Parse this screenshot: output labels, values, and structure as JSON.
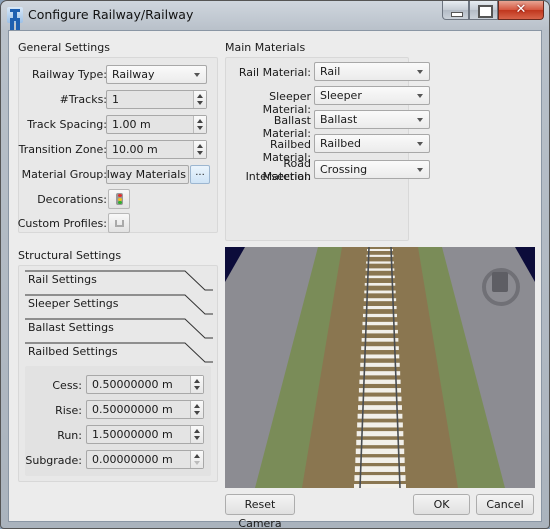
{
  "window": {
    "title": "Configure Railway/Railway",
    "controls": {
      "minimize": "minimize",
      "maximize": "maximize",
      "close": "✕"
    }
  },
  "general_settings": {
    "title": "General Settings",
    "railway_type": {
      "label": "Railway Type:",
      "value": "Railway"
    },
    "tracks": {
      "label": "#Tracks:",
      "value": "1"
    },
    "track_spacing": {
      "label": "Track Spacing:",
      "value": "1.00 m"
    },
    "transition_zone": {
      "label": "Transition Zone:",
      "value": "10.00 m"
    },
    "material_group": {
      "label": "Material Group:",
      "value": "/Railway Materials",
      "browse_label": "..."
    },
    "decorations": {
      "label": "Decorations:",
      "icon": "traffic-light-icon"
    },
    "custom_profiles": {
      "label": "Custom Profiles:",
      "icon": "profile-icon"
    }
  },
  "main_materials": {
    "title": "Main Materials",
    "rail": {
      "label": "Rail Material:",
      "value": "Rail"
    },
    "sleeper": {
      "label": "Sleeper Material:",
      "value": "Sleeper"
    },
    "ballast": {
      "label": "Ballast Material:",
      "value": "Ballast"
    },
    "railbed": {
      "label": "Railbed Material:",
      "value": "Railbed"
    },
    "road_intersection": {
      "label_line1": "Road Intersection",
      "label_line2": "Material:",
      "value": "Crossing"
    }
  },
  "structural_settings": {
    "title": "Structural Settings",
    "tabs": [
      {
        "label": "Rail Settings"
      },
      {
        "label": "Sleeper Settings"
      },
      {
        "label": "Ballast Settings"
      },
      {
        "label": "Railbed Settings"
      }
    ],
    "railbed": {
      "cess": {
        "label": "Cess:",
        "value": "0.50000000 m"
      },
      "rise": {
        "label": "Rise:",
        "value": "0.50000000 m"
      },
      "run": {
        "label": "Run:",
        "value": "1.50000000 m"
      },
      "subgrade": {
        "label": "Subgrade:",
        "value": "0.00000000 m"
      }
    }
  },
  "preview": {
    "colors": {
      "ground": "#8c8c92",
      "grass": "#7a8c58",
      "ballast": "#8a7650",
      "sleeper": "#f2f0ea",
      "rail": "#4a4e52",
      "sky": "#0c0c3a"
    }
  },
  "buttons": {
    "reset_camera": "Reset Camera",
    "ok": "OK",
    "cancel": "Cancel"
  }
}
